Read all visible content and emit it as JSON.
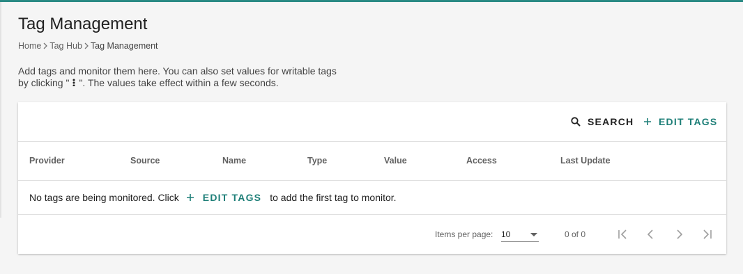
{
  "page": {
    "title": "Tag Management",
    "accent_color": "#2a8a84",
    "action_color": "#1e7f78"
  },
  "breadcrumb": {
    "items": [
      "Home",
      "Tag Hub",
      "Tag Management"
    ]
  },
  "description": {
    "line1": "Add tags and monitor them here. You can also set values for writable tags",
    "line2_prefix": "by clicking \"",
    "more_icon": "more-vert-icon",
    "line2_suffix": "\". The values take effect within a few seconds."
  },
  "toolbar": {
    "search_label": "SEARCH",
    "search_icon": "search-icon",
    "edit_tags_label": "EDIT TAGS",
    "edit_tags_icon": "plus-icon"
  },
  "table": {
    "columns": [
      "Provider",
      "Source",
      "Name",
      "Type",
      "Value",
      "Access",
      "Last Update"
    ],
    "empty_message": {
      "prefix": "No tags are being monitored. Click",
      "action_label": "EDIT TAGS",
      "suffix": "to add the first tag to monitor."
    }
  },
  "paginator": {
    "items_per_page_label": "Items per page:",
    "items_per_page_value": "10",
    "range_label": "0 of 0",
    "buttons": [
      "first-page-icon",
      "previous-page-icon",
      "next-page-icon",
      "last-page-icon"
    ]
  }
}
